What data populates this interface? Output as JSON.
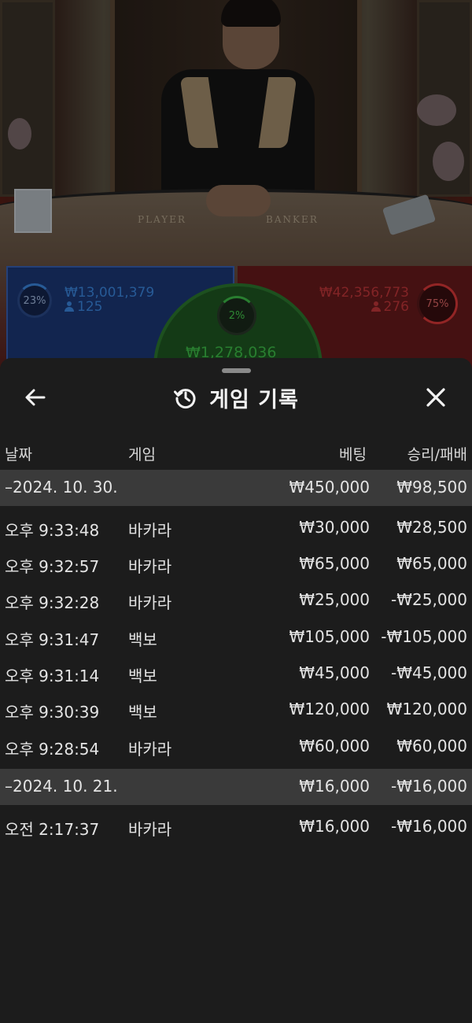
{
  "stream": {
    "table_labels": [
      "PLAYER",
      "BANKER"
    ],
    "player": {
      "percent": "23%",
      "amount": "₩13,001,379",
      "count": "125"
    },
    "banker": {
      "percent": "75%",
      "amount": "₩42,356,773",
      "count": "276"
    },
    "tie": {
      "percent": "2%",
      "amount": "₩1,278,036"
    },
    "colors": {
      "player": "#3c8ae6",
      "banker": "#e0393a",
      "tie": "#3fc24a"
    }
  },
  "sheet": {
    "title": "게임 기록",
    "title_icon": "history-icon",
    "back_icon": "arrow-left-icon",
    "close_icon": "close-icon",
    "columns": {
      "date": "날짜",
      "game": "게임",
      "bet": "베팅",
      "result": "승리/패배"
    },
    "groups": [
      {
        "date": "–2024. 10. 30.",
        "bet_total": "₩450,000",
        "result_total": "₩98,500",
        "rows": [
          {
            "time": "오후 9:33:48",
            "game": "바카라",
            "bet": "₩30,000",
            "result": "₩28,500"
          },
          {
            "time": "오후 9:32:57",
            "game": "바카라",
            "bet": "₩65,000",
            "result": "₩65,000"
          },
          {
            "time": "오후 9:32:28",
            "game": "바카라",
            "bet": "₩25,000",
            "result": "-₩25,000"
          },
          {
            "time": "오후 9:31:47",
            "game": "백보",
            "bet": "₩105,000",
            "result": "-₩105,000"
          },
          {
            "time": "오후 9:31:14",
            "game": "백보",
            "bet": "₩45,000",
            "result": "-₩45,000"
          },
          {
            "time": "오후 9:30:39",
            "game": "백보",
            "bet": "₩120,000",
            "result": "₩120,000"
          },
          {
            "time": "오후 9:28:54",
            "game": "바카라",
            "bet": "₩60,000",
            "result": "₩60,000"
          }
        ]
      },
      {
        "date": "–2024. 10. 21.",
        "bet_total": "₩16,000",
        "result_total": "-₩16,000",
        "rows": [
          {
            "time": "오전 2:17:37",
            "game": "바카라",
            "bet": "₩16,000",
            "result": "-₩16,000"
          }
        ]
      }
    ]
  }
}
